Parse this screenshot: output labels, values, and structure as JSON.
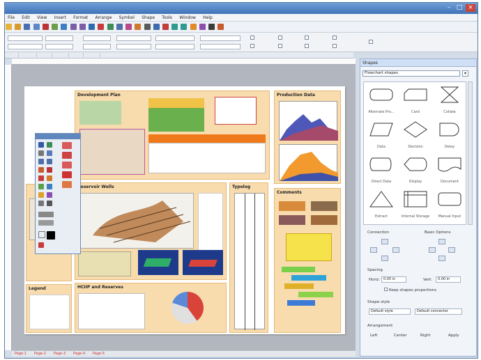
{
  "menu": [
    "File",
    "Edit",
    "View",
    "Insert",
    "Format",
    "Arrange",
    "Symbol",
    "Shape",
    "Tools",
    "Window",
    "Help"
  ],
  "sections": {
    "development_plan": "Development Plan",
    "production_data": "Production Data",
    "reservoir_wells": "Reservoir Wells",
    "typelog": "Typelog",
    "comments": "Comments",
    "legend": "Legend",
    "hcip_reserves": "HCIIP and Reserves"
  },
  "shapes_panel": {
    "title": "Shapes",
    "selector": "Flowchart shapes",
    "items": [
      {
        "label": "Alternate Pro...",
        "icon": "rounded-rect-icon"
      },
      {
        "label": "Card",
        "icon": "card-icon"
      },
      {
        "label": "Collate",
        "icon": "collate-icon"
      },
      {
        "label": "Data",
        "icon": "parallelogram-icon"
      },
      {
        "label": "Decision",
        "icon": "diamond-icon"
      },
      {
        "label": "Delay",
        "icon": "delay-icon"
      },
      {
        "label": "Direct Data",
        "icon": "cylinder-icon"
      },
      {
        "label": "Display",
        "icon": "display-icon"
      },
      {
        "label": "Document",
        "icon": "document-icon"
      },
      {
        "label": "Extract",
        "icon": "triangle-icon"
      },
      {
        "label": "Internal Storage",
        "icon": "internal-storage-icon"
      },
      {
        "label": "Manual Input",
        "icon": "manual-input-icon"
      }
    ],
    "group_labels": {
      "connection": "Connection",
      "basic_options": "Basic Options",
      "spacing": "Spacing",
      "horizontal": "Horiz:",
      "vertical": "Vert:",
      "horiz_value": "0.00 in",
      "vert_value": "0.00 in",
      "keep_checkbox": "Keep shapes proportions",
      "styles_label": "Shape style",
      "default_style": "Default style",
      "connector_style": "Default connector",
      "arrangement": "Arrangement",
      "buttons": [
        "Left",
        "Center",
        "Right",
        "Apply"
      ]
    }
  },
  "page_tabs": [
    "Page-1",
    "Page-2",
    "Page-3",
    "Page-4",
    "Page-5"
  ],
  "colors": {
    "section_bg": "#f8dcae",
    "titlebar": "#4f80c2",
    "accent": "#e05a1a"
  }
}
